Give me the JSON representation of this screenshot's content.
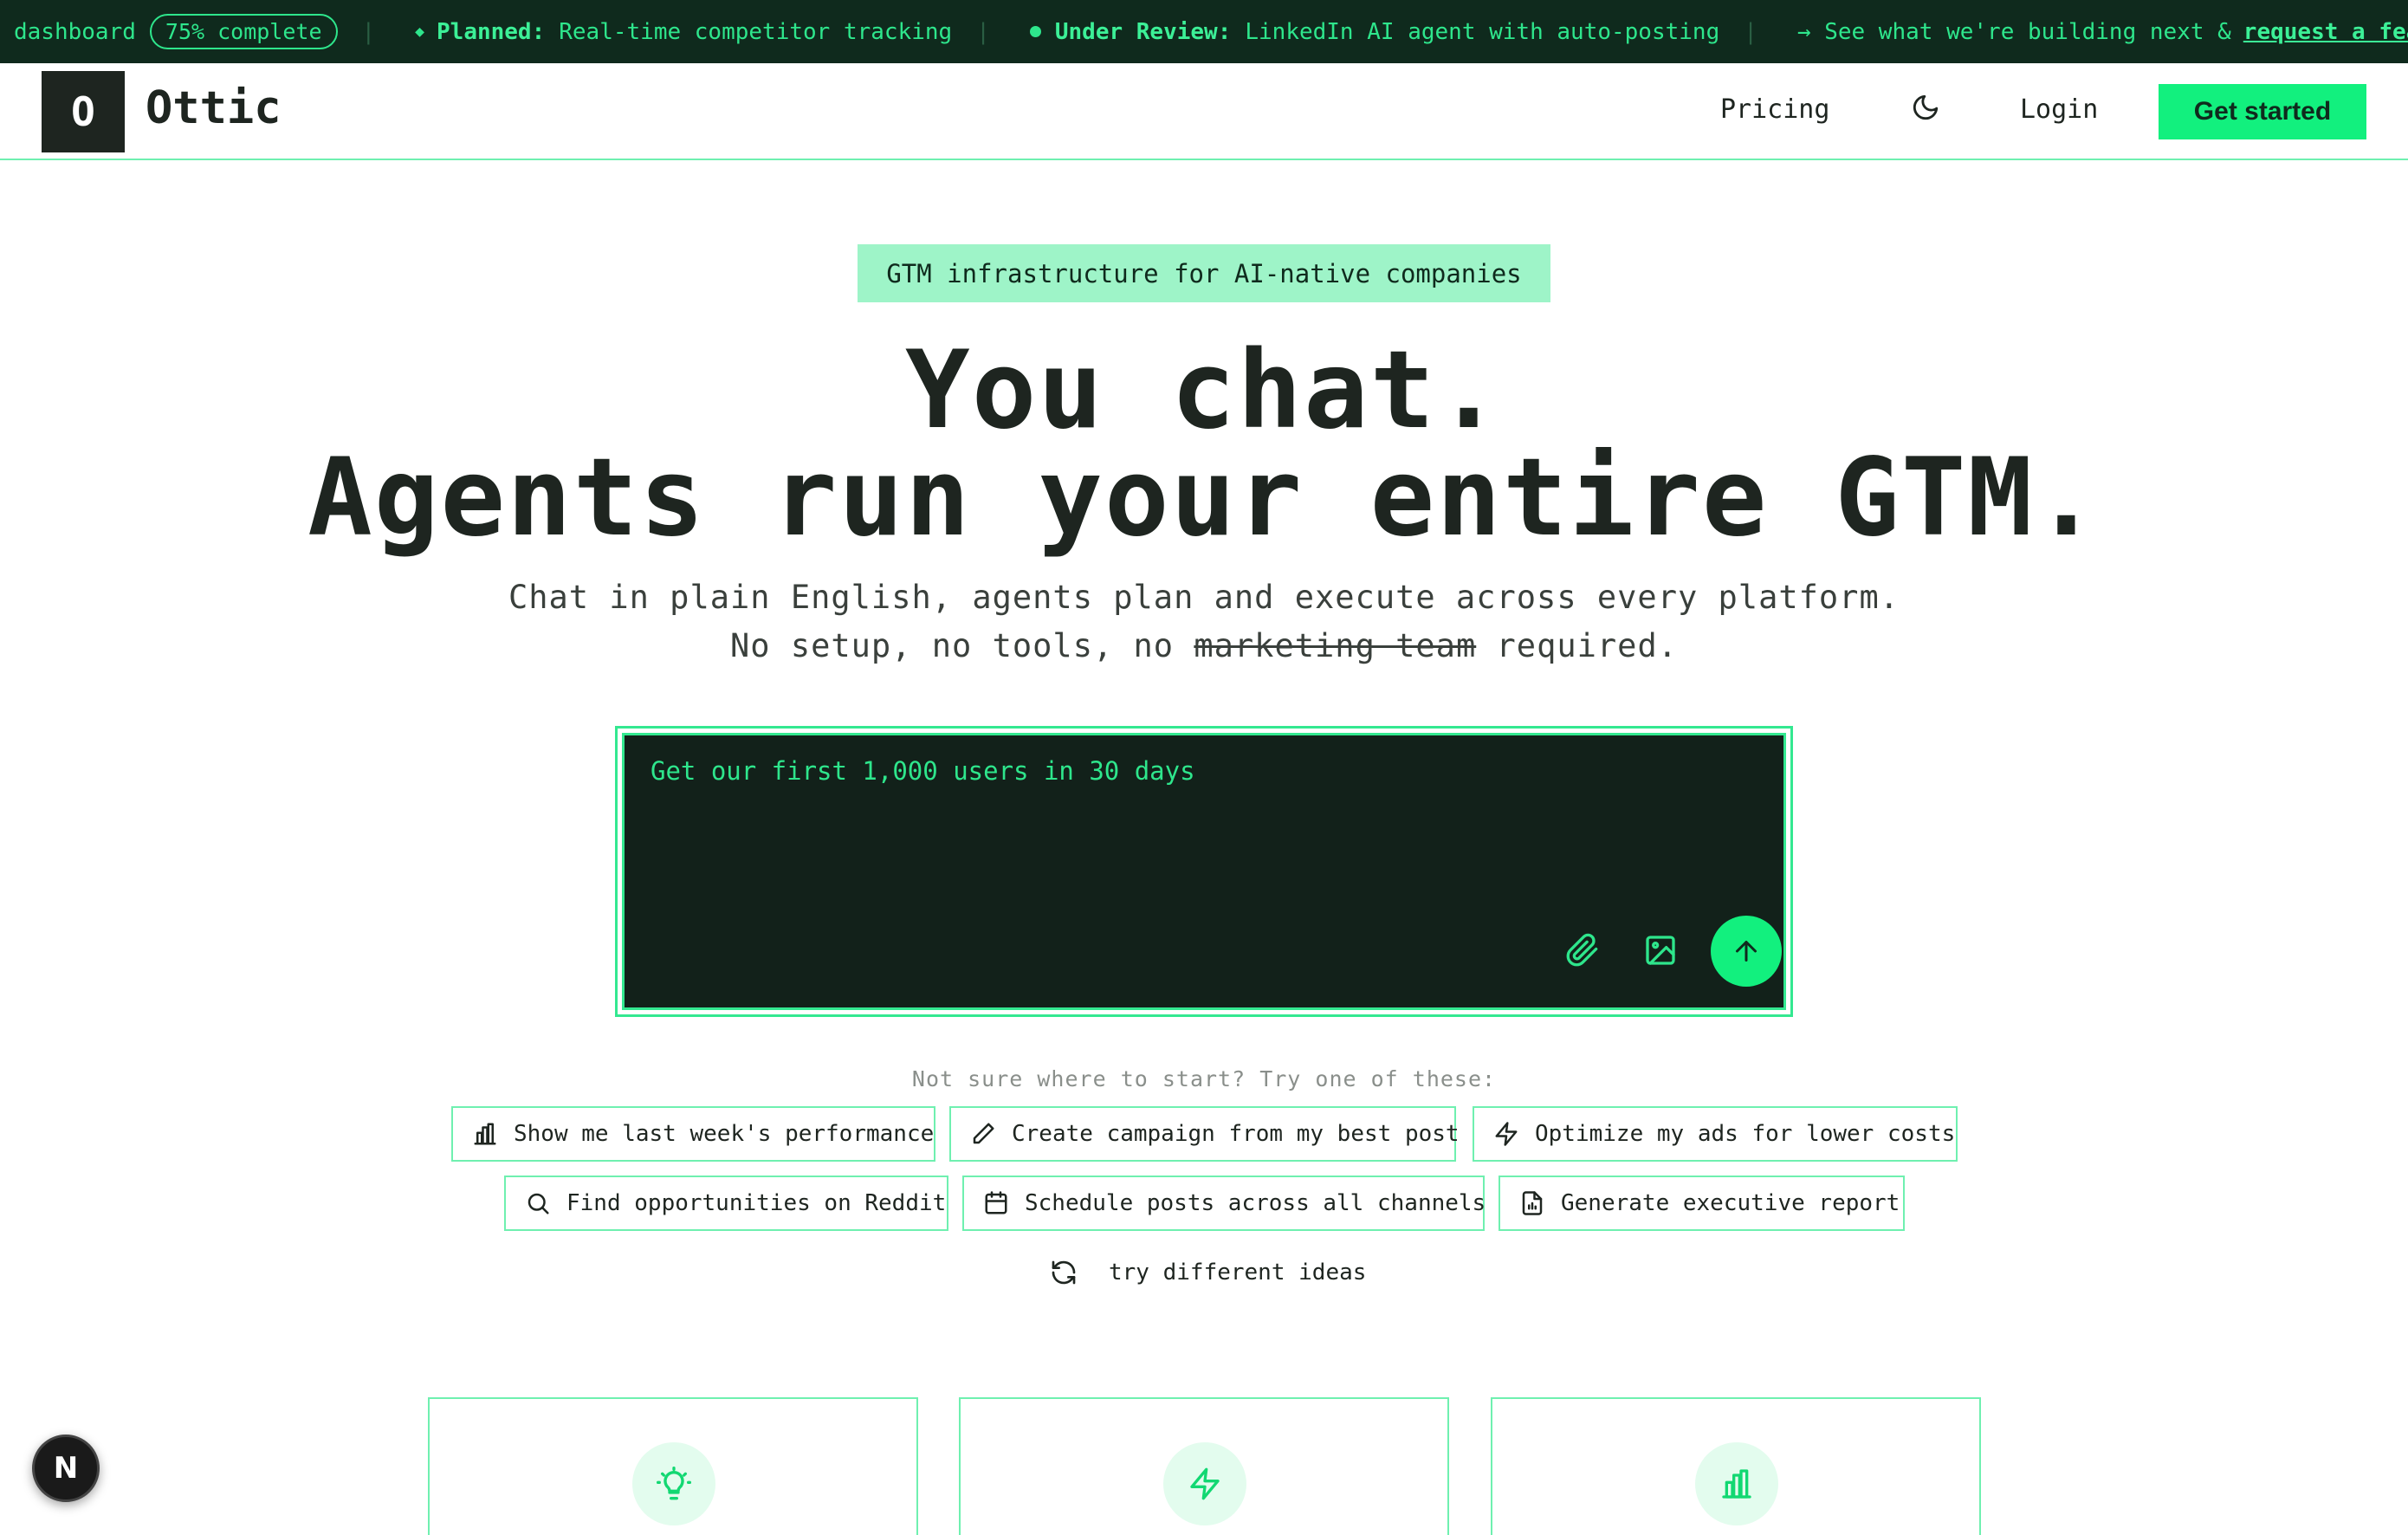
{
  "topbar": {
    "dashboard_label": "dashboard",
    "progress_label": "75% complete",
    "progress_value": 0.75,
    "separator": "|",
    "planned_label": "Planned:",
    "planned_text": "Real-time competitor tracking",
    "review_label": "Under Review:",
    "review_text": "LinkedIn AI agent with auto-posting",
    "cta_text": "→ See what we're building next &",
    "cta_link": "request a feature"
  },
  "nav": {
    "logo_letter": "O",
    "brand": "Ottic",
    "pricing": "Pricing",
    "login": "Login",
    "get_started": "Get started",
    "theme_icon": "moon-icon"
  },
  "hero": {
    "badge": "GTM infrastructure for AI-native companies",
    "line1": "You chat.",
    "line2": "Agents run your entire GTM.",
    "sub1": "Chat in plain English, agents plan and execute across every platform.",
    "sub2_before": "No setup, no tools, no",
    "sub2_strike": "marketing team",
    "sub2_after": "required."
  },
  "chat": {
    "placeholder": "Get our first 1,000 users in 30 days",
    "attach_icon": "paperclip-icon",
    "image_icon": "image-icon",
    "send_icon": "arrow-up-icon"
  },
  "suggestions": {
    "hint": "Not sure where to start? Try one of these:",
    "chips": [
      {
        "label": "Show me last week's performance",
        "icon": "bar-chart-icon"
      },
      {
        "label": "Create campaign from my best post",
        "icon": "pencil-icon"
      },
      {
        "label": "Optimize my ads for lower costs",
        "icon": "bolt-icon"
      },
      {
        "label": "Find opportunities on Reddit",
        "icon": "search-icon"
      },
      {
        "label": "Schedule posts across all channels",
        "icon": "calendar-icon"
      },
      {
        "label": "Generate executive report",
        "icon": "document-icon"
      }
    ],
    "refresh": "try different ideas"
  },
  "cards": [
    {
      "icon": "lightbulb-icon"
    },
    {
      "icon": "bolt-icon"
    },
    {
      "icon": "bar-chart-icon"
    }
  ],
  "fab": {
    "letter": "N"
  },
  "colors": {
    "accent": "#12f07e",
    "dark": "#0f2a1d",
    "chat_bg": "#12211a",
    "border": "#6ff0b0",
    "text": "#1e2520"
  }
}
